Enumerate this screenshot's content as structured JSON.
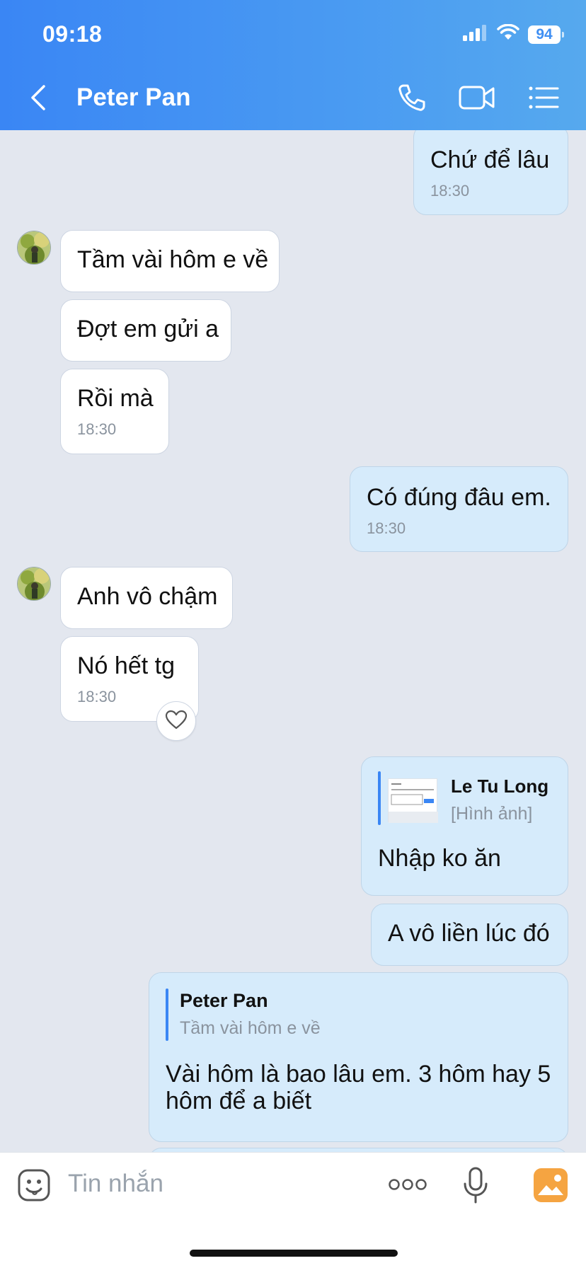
{
  "status_bar": {
    "time": "09:18",
    "battery": "94"
  },
  "header": {
    "title": "Peter Pan"
  },
  "messages": [
    {
      "dir": "out",
      "text": "Chứ để lâu",
      "time": "18:30"
    },
    {
      "dir": "in",
      "text": "Tầm vài hôm e về"
    },
    {
      "dir": "in",
      "text": "Đợt em gửi a"
    },
    {
      "dir": "in",
      "text": "Rồi mà",
      "time": "18:30"
    },
    {
      "dir": "out",
      "text": "Có đúng đâu em.",
      "time": "18:30"
    },
    {
      "dir": "in",
      "text": "Anh vô chậm"
    },
    {
      "dir": "in",
      "text": "Nó hết tg",
      "time": "18:30"
    },
    {
      "dir": "out",
      "quote_author": "Le Tu Long",
      "quote_text": "[Hình ảnh]",
      "text": "Nhập ko ăn"
    },
    {
      "dir": "out",
      "text": "A vô liền lúc đó"
    },
    {
      "dir": "out",
      "quote_author": "Peter Pan",
      "quote_text": "Tầm vài hôm e về",
      "text_line1": "Vài hôm là bao lâu em. 3 hôm hay 5",
      "text_line2": "hôm để a biết"
    }
  ],
  "input": {
    "placeholder": "Tin nhắn"
  },
  "colors": {
    "header_start": "#3a86f4",
    "header_end": "#56a9ee",
    "outgoing_bubble": "#d6ebfb",
    "incoming_bubble": "#ffffff",
    "background": "#e3e7ef"
  }
}
